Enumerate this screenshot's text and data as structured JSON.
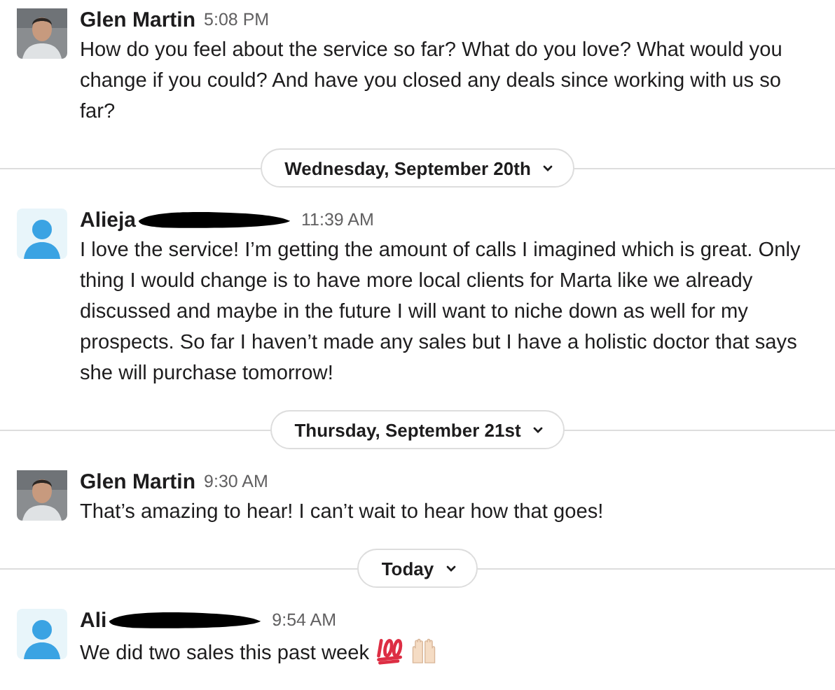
{
  "items": [
    {
      "kind": "message",
      "has_photo": true,
      "author": "Glen Martin",
      "redacted": false,
      "time": "5:08 PM",
      "text": "How do you feel about the service so far? What do you love? What would you change if you could? And have you closed any deals since working with us so far?"
    },
    {
      "kind": "divider",
      "label": "Wednesday, September 20th"
    },
    {
      "kind": "message",
      "has_photo": false,
      "author": "Alieja",
      "redacted": true,
      "time": "11:39 AM",
      "text": "I love the service! I’m getting the amount of calls I imagined which is great. Only thing I would change is to have more local clients for Marta like we already discussed and maybe in the future I will want to niche down as well for my prospects. So far I haven’t made any sales but I have a holistic doctor that says she will purchase tomorrow!"
    },
    {
      "kind": "divider",
      "label": "Thursday, September 21st"
    },
    {
      "kind": "message",
      "has_photo": true,
      "author": "Glen Martin",
      "redacted": false,
      "time": "9:30 AM",
      "text": "That’s amazing to hear! I can’t wait to hear how that goes!"
    },
    {
      "kind": "divider",
      "label": "Today"
    },
    {
      "kind": "message",
      "has_photo": false,
      "author": "Ali",
      "redacted": true,
      "time": "9:54 AM",
      "text": "We did two sales this past week",
      "emoji": [
        {
          "kind": "hundred"
        },
        {
          "kind": "hands"
        }
      ]
    }
  ]
}
